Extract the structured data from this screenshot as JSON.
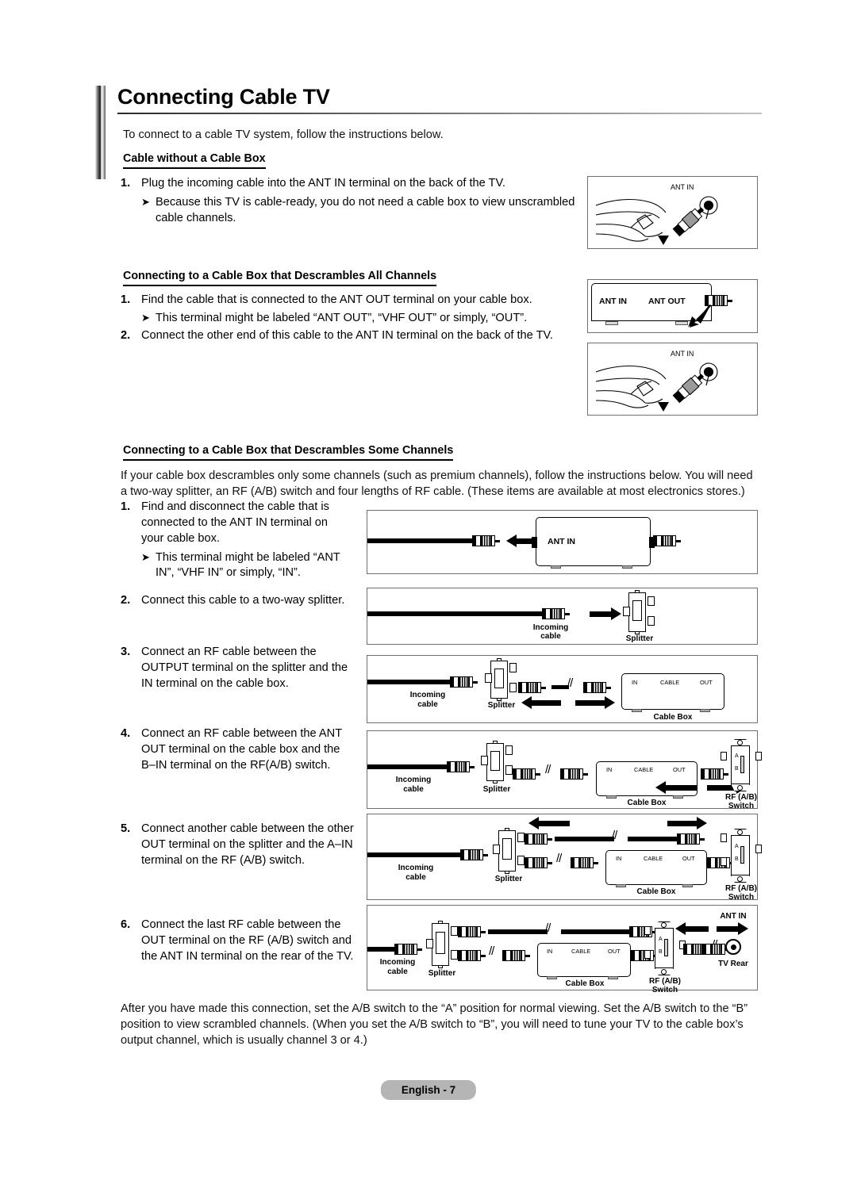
{
  "page": {
    "title": "Connecting Cable TV",
    "intro": "To connect to a cable TV system, follow the instructions below.",
    "footer_label": "English - 7"
  },
  "section_no_box": {
    "heading": "Cable without a Cable Box",
    "steps": [
      {
        "num": "1.",
        "text": "Plug the incoming cable into the ANT IN terminal on the back of the TV.",
        "bullet": "Because this TV is cable-ready, you do not need a cable box to view unscrambled cable channels."
      }
    ]
  },
  "section_all_channels": {
    "heading": "Connecting to a Cable Box that Descrambles All Channels",
    "steps": [
      {
        "num": "1.",
        "text": "Find the cable that is connected to the ANT OUT terminal on your cable box.",
        "bullet": "This terminal might be labeled “ANT OUT”, “VHF OUT” or simply, “OUT”."
      },
      {
        "num": "2.",
        "text": "Connect the other end of this cable to the ANT IN terminal on the back of the TV.",
        "bullet": ""
      }
    ]
  },
  "section_some_channels": {
    "heading": "Connecting to a Cable Box that Descrambles Some Channels",
    "intro": "If your cable box descrambles only some channels (such as premium channels), follow the instructions below. You will need a two-way splitter, an RF (A/B) switch and four lengths of RF cable. (These items are available at most electronics stores.)",
    "steps": [
      {
        "num": "1.",
        "text": "Find and disconnect the cable that is connected to the ANT IN terminal on your cable box.",
        "bullet": "This terminal might be labeled “ANT IN”, “VHF IN” or simply, “IN”."
      },
      {
        "num": "2.",
        "text": "Connect this cable to a two-way splitter.",
        "bullet": ""
      },
      {
        "num": "3.",
        "text": "Connect an RF cable between the OUTPUT terminal on the splitter and the IN terminal on the cable box.",
        "bullet": ""
      },
      {
        "num": "4.",
        "text": "Connect an RF cable between the ANT OUT terminal on the cable box and the B–IN terminal on the RF(A/B) switch.",
        "bullet": ""
      },
      {
        "num": "5.",
        "text": "Connect another cable between the other OUT terminal on the splitter and the A–IN terminal on the RF (A/B) switch.",
        "bullet": ""
      },
      {
        "num": "6.",
        "text": "Connect the last RF cable between the OUT terminal on the RF (A/B) switch and the ANT IN terminal on the rear of the TV.",
        "bullet": ""
      }
    ],
    "closing": "After you have made this connection, set the A/B switch to the “A” position for normal viewing. Set the A/B switch to the “B” position to view scrambled channels. (When you set the A/B switch to “B”, you will need to tune your TV to the cable box’s output channel, which is usually channel 3 or 4.)"
  },
  "figures": {
    "hand_ant_in_1": {
      "label": "ANT IN"
    },
    "cable_box_ports": {
      "ant_in": "ANT IN",
      "ant_out": "ANT OUT"
    },
    "hand_ant_in_2": {
      "label": "ANT IN"
    },
    "fig1": {
      "ant_in": "ANT IN"
    },
    "fig2": {
      "incoming": "Incoming\ncable",
      "incoming_l1": "Incoming",
      "incoming_l2": "cable",
      "splitter": "Splitter"
    },
    "fig3": {
      "incoming_l1": "Incoming",
      "incoming_l2": "cable",
      "splitter": "Splitter",
      "cable_box": "Cable Box",
      "port_in": "IN",
      "port_cable": "CABLE",
      "port_out": "OUT"
    },
    "fig4": {
      "incoming_l1": "Incoming",
      "incoming_l2": "cable",
      "splitter": "Splitter",
      "cable_box": "Cable Box",
      "port_in": "IN",
      "port_cable": "CABLE",
      "port_out": "OUT",
      "rf_l1": "RF (A/B)",
      "rf_l2": "Switch",
      "sw_a": "A",
      "sw_b": "B"
    },
    "fig5": {
      "incoming_l1": "Incoming",
      "incoming_l2": "cable",
      "splitter": "Splitter",
      "cable_box": "Cable Box",
      "port_in": "IN",
      "port_cable": "CABLE",
      "port_out": "OUT",
      "rf_l1": "RF (A/B)",
      "rf_l2": "Switch",
      "sw_a": "A",
      "sw_b": "B"
    },
    "fig6": {
      "incoming_l1": "Incoming",
      "incoming_l2": "cable",
      "splitter": "Splitter",
      "cable_box": "Cable Box",
      "port_in": "IN",
      "port_cable": "CABLE",
      "port_out": "OUT",
      "rf_l1": "RF (A/B)",
      "rf_l2": "Switch",
      "sw_a": "A",
      "sw_b": "B",
      "ant_in": "ANT IN",
      "tv_rear": "TV Rear"
    }
  },
  "colors": {
    "page_bg": "#ffffff",
    "text": "#000000",
    "frame": "#6f6f6f",
    "footer_pill": "#b5b5b5"
  }
}
